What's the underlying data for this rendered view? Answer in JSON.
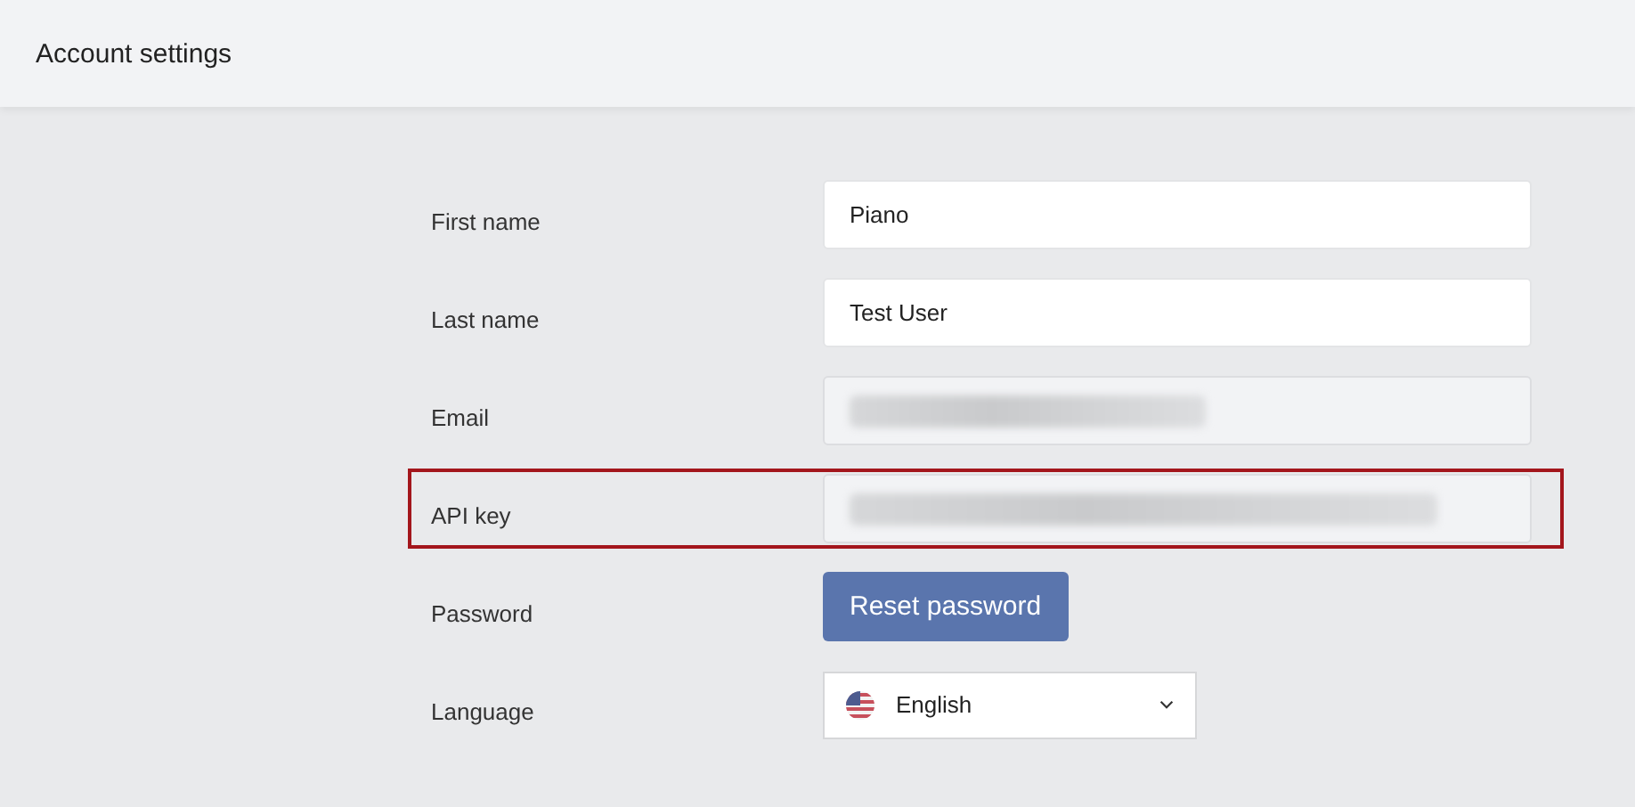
{
  "header": {
    "title": "Account settings"
  },
  "rows": [
    {
      "label": "First name",
      "kind": "input",
      "value": "Piano",
      "disabled": false,
      "redacted": false,
      "highlighted": false
    },
    {
      "label": "Last name",
      "kind": "input",
      "value": "Test User",
      "disabled": false,
      "redacted": false,
      "highlighted": false
    },
    {
      "label": "Email",
      "kind": "input",
      "disabled": true,
      "redacted": true,
      "highlighted": false
    },
    {
      "label": "API key",
      "kind": "input",
      "disabled": true,
      "redacted": true,
      "highlighted": true
    },
    {
      "label": "Password",
      "kind": "button",
      "value": "Reset password",
      "highlighted": false
    },
    {
      "label": "Language",
      "kind": "select",
      "value": "English",
      "highlighted": false
    }
  ]
}
